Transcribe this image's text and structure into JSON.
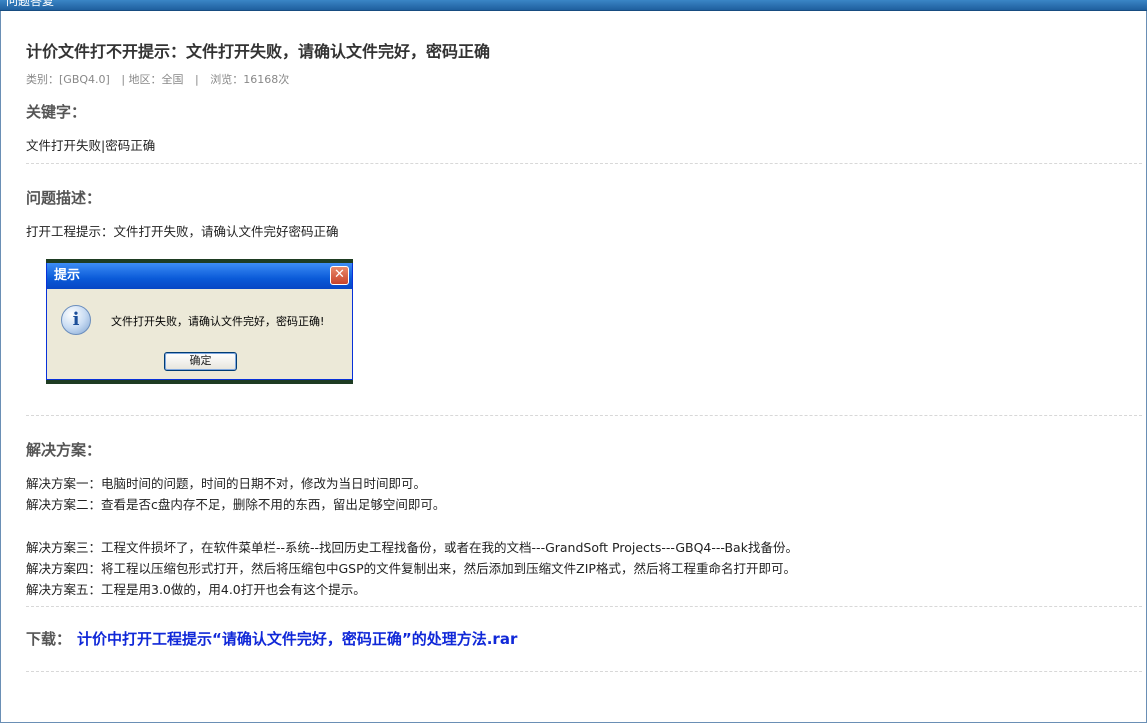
{
  "topbar": {
    "title": "问题答复"
  },
  "article": {
    "title": "计价文件打不开提示：文件打开失败，请确认文件完好，密码正确",
    "meta": {
      "category": "类别：[GBQ4.0]",
      "region": "| 地区：全国",
      "sep": "|",
      "views": "浏览：16168次"
    },
    "keywords": {
      "heading": "关键字：",
      "text": "文件打开失败|密码正确"
    },
    "problem": {
      "heading": "问题描述：",
      "text": "打开工程提示：文件打开失败，请确认文件完好密码正确",
      "dialog": {
        "title": "提示",
        "close_symbol": "✕",
        "icon": "info-icon",
        "message": "文件打开失败，请确认文件完好，密码正确!",
        "ok_label": "确定"
      }
    },
    "solution": {
      "heading": "解决方案：",
      "lines": [
        "解决方案一：电脑时间的问题，时间的日期不对，修改为当日时间即可。",
        "解决方案二：查看是否c盘内存不足，删除不用的东西，留出足够空间即可。",
        "解决方案三：工程文件损坏了，在软件菜单栏--系统--找回历史工程找备份，或者在我的文档---GrandSoft Projects---GBQ4---Bak找备份。",
        "解决方案四：将工程以压缩包形式打开，然后将压缩包中GSP的文件复制出来，然后添加到压缩文件ZIP格式，然后将工程重命名打开即可。",
        "解决方案五：工程是用3.0做的，用4.0打开也会有这个提示。"
      ]
    },
    "download": {
      "label": "下载：",
      "link_text": "计价中打开工程提示“请确认文件完好，密码正确”的处理方法.rar"
    }
  },
  "colors": {
    "link": "#1028d8",
    "topbar": "#2a6fb0"
  }
}
